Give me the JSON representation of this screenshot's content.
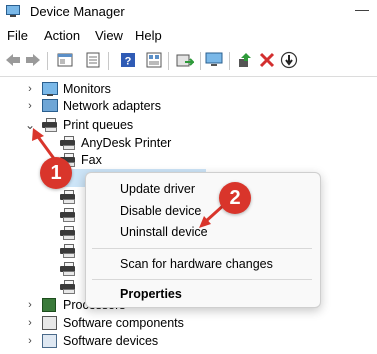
{
  "window": {
    "title": "Device Manager",
    "minimize_glyph": "—"
  },
  "menu": [
    "File",
    "Action",
    "View",
    "Help"
  ],
  "toolbar_icons": [
    "back-icon",
    "forward-icon",
    "properties-icon",
    "details-icon",
    "help-icon",
    "device-view-icon",
    "scan-icon",
    "monitor-icon",
    "update-driver-icon",
    "uninstall-icon",
    "disable-icon"
  ],
  "tree": {
    "monitors": "Monitors",
    "network": "Network adapters",
    "print_queues": "Print queues",
    "anydesk": "AnyDesk Printer",
    "fax": "Fax",
    "processors": "Processors",
    "software_components": "Software components",
    "software_devices": "Software devices"
  },
  "context_menu": {
    "update": "Update driver",
    "disable": "Disable device",
    "uninstall": "Uninstall device",
    "scan": "Scan for hardware changes",
    "properties": "Properties"
  },
  "callouts": {
    "one": "1",
    "two": "2"
  },
  "colors": {
    "callout": "#d9352b",
    "selection": "#cce4f7",
    "uninstall_x": "#d32f2f"
  }
}
